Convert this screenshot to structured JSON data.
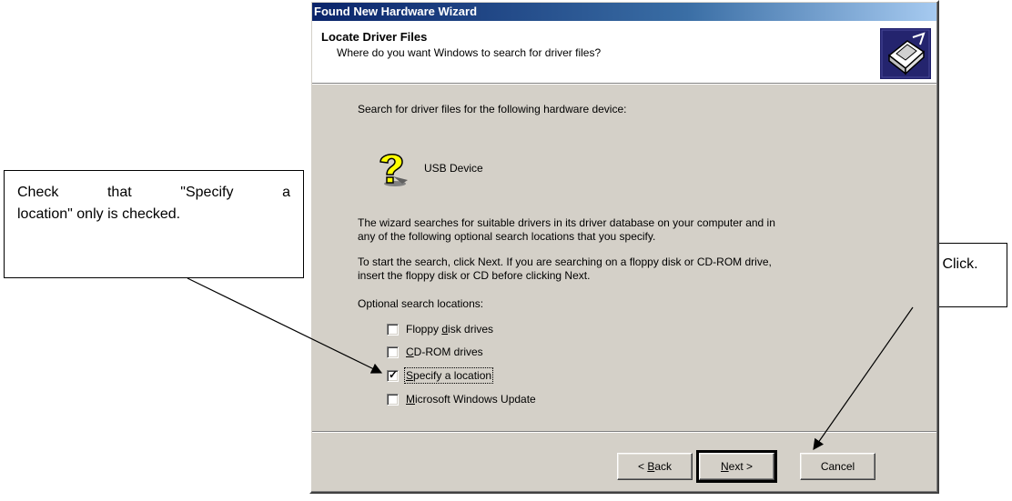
{
  "annotations": {
    "left_callout_line1_words": [
      "Check",
      "that",
      "\"Specify",
      "a"
    ],
    "left_callout_line2": "location\" only is checked.",
    "right_callout": "Click."
  },
  "window": {
    "title": "Found New Hardware Wizard"
  },
  "header": {
    "title": "Locate Driver Files",
    "subtitle": "Where do you want Windows to search for driver files?",
    "icon": "hardware-wizard-icon"
  },
  "body": {
    "search_for_text": "Search for driver files for the following hardware device:",
    "device_icon": "question-mark-device-icon",
    "device_name": "USB Device",
    "description_line1": "The wizard searches for suitable drivers in its driver database on your computer and in",
    "description_line2": "any of the following optional search locations that you specify.",
    "instruction_line1": "To start the search, click Next. If you are searching on a floppy disk or CD-ROM drive,",
    "instruction_line2": "insert the floppy disk or CD before clicking Next.",
    "optional_label": "Optional search locations:"
  },
  "options": [
    {
      "label_pre": "Floppy ",
      "accel": "d",
      "label_post": "isk drives",
      "checked": false
    },
    {
      "label_pre": "",
      "accel": "C",
      "label_post": "D-ROM drives",
      "checked": false
    },
    {
      "label_pre": "",
      "accel": "S",
      "label_post": "pecify a location",
      "checked": true
    },
    {
      "label_pre": "",
      "accel": "M",
      "label_post": "icrosoft Windows Update",
      "checked": false
    }
  ],
  "buttons": {
    "back_pre": "< ",
    "back_accel": "B",
    "back_post": "ack",
    "next_accel": "N",
    "next_post": "ext >",
    "cancel": "Cancel"
  },
  "colors": {
    "title_bar": "#0a246a",
    "dialog_face": "#d4d0c8"
  }
}
